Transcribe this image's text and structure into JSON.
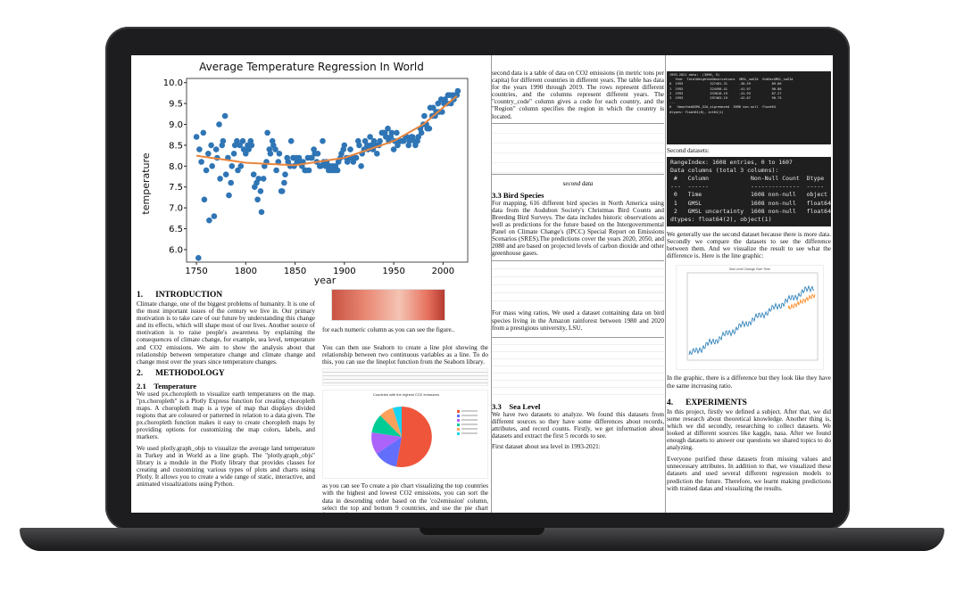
{
  "regression_chart": {
    "title": "Average Temperature Regression In World",
    "ylabel": "temperature",
    "xlabel": "year",
    "y_ticks": [
      "10.0",
      "9.5",
      "9.0",
      "8.5",
      "8.0",
      "7.5",
      "7.0",
      "6.5",
      "6.0"
    ],
    "x_ticks": [
      "1750",
      "1800",
      "1850",
      "1900",
      "1950",
      "2000"
    ],
    "point_color": "#2f75b5",
    "line_color": "#e8853d"
  },
  "chart_data": {
    "type": "scatter",
    "title": "Average Temperature Regression In World",
    "xlabel": "year",
    "ylabel": "temperature",
    "xlim": [
      1740,
      2025
    ],
    "ylim": [
      5.7,
      10.1
    ],
    "series": [
      {
        "values": [
          [
            1750,
            8.7
          ],
          [
            1752,
            5.8
          ],
          [
            1753,
            8.4
          ],
          [
            1755,
            8.1
          ],
          [
            1757,
            8.8
          ],
          [
            1758,
            7.2
          ],
          [
            1760,
            7.9
          ],
          [
            1762,
            8.3
          ],
          [
            1763,
            6.7
          ],
          [
            1765,
            8.5
          ],
          [
            1766,
            8.0
          ],
          [
            1768,
            6.8
          ],
          [
            1770,
            8.4
          ],
          [
            1771,
            8.2
          ],
          [
            1773,
            9.0
          ],
          [
            1774,
            7.7
          ],
          [
            1776,
            8.5
          ],
          [
            1777,
            8.6
          ],
          [
            1779,
            9.2
          ],
          [
            1780,
            7.8
          ],
          [
            1782,
            8.2
          ],
          [
            1783,
            7.3
          ],
          [
            1785,
            7.6
          ],
          [
            1786,
            8.0
          ],
          [
            1788,
            8.3
          ],
          [
            1789,
            8.5
          ],
          [
            1791,
            8.6
          ],
          [
            1792,
            7.9
          ],
          [
            1794,
            8.5
          ],
          [
            1795,
            8.0
          ],
          [
            1797,
            8.6
          ],
          [
            1798,
            8.4
          ],
          [
            1800,
            8.3
          ],
          [
            1802,
            8.5
          ],
          [
            1803,
            8.4
          ],
          [
            1805,
            8.6
          ],
          [
            1806,
            8.5
          ],
          [
            1808,
            7.8
          ],
          [
            1809,
            7.5
          ],
          [
            1811,
            7.6
          ],
          [
            1812,
            7.2
          ],
          [
            1813,
            7.7
          ],
          [
            1815,
            7.4
          ],
          [
            1816,
            6.9
          ],
          [
            1818,
            7.7
          ],
          [
            1819,
            8.0
          ],
          [
            1821,
            8.1
          ],
          [
            1822,
            8.8
          ],
          [
            1824,
            8.4
          ],
          [
            1825,
            8.3
          ],
          [
            1827,
            8.6
          ],
          [
            1828,
            8.5
          ],
          [
            1830,
            8.4
          ],
          [
            1831,
            7.9
          ],
          [
            1833,
            8.1
          ],
          [
            1834,
            8.3
          ],
          [
            1836,
            7.4
          ],
          [
            1837,
            7.4
          ],
          [
            1839,
            7.6
          ],
          [
            1840,
            7.8
          ],
          [
            1842,
            8.2
          ],
          [
            1843,
            8.1
          ],
          [
            1845,
            8.0
          ],
          [
            1846,
            8.6
          ],
          [
            1848,
            8.2
          ],
          [
            1849,
            8.0
          ],
          [
            1851,
            8.2
          ],
          [
            1852,
            8.1
          ],
          [
            1854,
            8.2
          ],
          [
            1855,
            8.1
          ],
          [
            1857,
            8.0
          ],
          [
            1858,
            8.1
          ],
          [
            1860,
            7.9
          ],
          [
            1861,
            7.9
          ],
          [
            1863,
            8.2
          ],
          [
            1864,
            7.9
          ],
          [
            1866,
            8.2
          ],
          [
            1867,
            8.2
          ],
          [
            1869,
            8.4
          ],
          [
            1870,
            8.3
          ],
          [
            1872,
            8.1
          ],
          [
            1873,
            8.3
          ],
          [
            1875,
            8.0
          ],
          [
            1876,
            8.0
          ],
          [
            1878,
            8.6
          ],
          [
            1879,
            8.1
          ],
          [
            1881,
            8.0
          ],
          [
            1882,
            8.1
          ],
          [
            1884,
            7.9
          ],
          [
            1885,
            8.0
          ],
          [
            1887,
            7.9
          ],
          [
            1888,
            8.0
          ],
          [
            1890,
            7.9
          ],
          [
            1891,
            8.0
          ],
          [
            1893,
            7.9
          ],
          [
            1894,
            8.1
          ],
          [
            1896,
            8.2
          ],
          [
            1897,
            8.3
          ],
          [
            1899,
            8.4
          ],
          [
            1900,
            8.5
          ],
          [
            1902,
            8.2
          ],
          [
            1903,
            8.1
          ],
          [
            1905,
            8.2
          ],
          [
            1906,
            8.4
          ],
          [
            1908,
            8.2
          ],
          [
            1909,
            8.1
          ],
          [
            1911,
            8.2
          ],
          [
            1912,
            8.2
          ],
          [
            1914,
            8.6
          ],
          [
            1915,
            8.5
          ],
          [
            1917,
            8.0
          ],
          [
            1918,
            8.3
          ],
          [
            1920,
            8.4
          ],
          [
            1921,
            8.6
          ],
          [
            1923,
            8.5
          ],
          [
            1924,
            8.4
          ],
          [
            1926,
            8.7
          ],
          [
            1927,
            8.5
          ],
          [
            1929,
            8.4
          ],
          [
            1930,
            8.6
          ],
          [
            1932,
            8.5
          ],
          [
            1933,
            8.3
          ],
          [
            1935,
            8.5
          ],
          [
            1936,
            8.6
          ],
          [
            1938,
            8.8
          ],
          [
            1939,
            8.8
          ],
          [
            1941,
            8.8
          ],
          [
            1942,
            8.7
          ],
          [
            1944,
            8.9
          ],
          [
            1945,
            8.6
          ],
          [
            1947,
            8.7
          ],
          [
            1948,
            8.8
          ],
          [
            1950,
            8.4
          ],
          [
            1951,
            8.6
          ],
          [
            1953,
            8.8
          ],
          [
            1954,
            8.5
          ],
          [
            1956,
            8.6
          ],
          [
            1957,
            8.6
          ],
          [
            1959,
            8.6
          ],
          [
            1960,
            8.6
          ],
          [
            1962,
            8.7
          ],
          [
            1963,
            8.7
          ],
          [
            1965,
            8.5
          ],
          [
            1966,
            8.6
          ],
          [
            1968,
            8.7
          ],
          [
            1969,
            8.7
          ],
          [
            1971,
            8.6
          ],
          [
            1972,
            8.5
          ],
          [
            1974,
            8.6
          ],
          [
            1975,
            8.7
          ],
          [
            1977,
            8.9
          ],
          [
            1978,
            8.8
          ],
          [
            1980,
            9.0
          ],
          [
            1981,
            9.2
          ],
          [
            1983,
            9.0
          ],
          [
            1984,
            8.9
          ],
          [
            1986,
            8.9
          ],
          [
            1987,
            9.4
          ],
          [
            1989,
            9.2
          ],
          [
            1990,
            9.4
          ],
          [
            1992,
            9.2
          ],
          [
            1993,
            9.3
          ],
          [
            1995,
            9.5
          ],
          [
            1996,
            9.3
          ],
          [
            1998,
            9.6
          ],
          [
            1999,
            9.3
          ],
          [
            2001,
            9.5
          ],
          [
            2002,
            9.6
          ],
          [
            2004,
            9.5
          ],
          [
            2005,
            9.7
          ],
          [
            2007,
            9.7
          ],
          [
            2008,
            9.5
          ],
          [
            2010,
            9.7
          ],
          [
            2011,
            9.6
          ],
          [
            2013,
            9.7
          ],
          [
            2014,
            9.7
          ],
          [
            2015,
            9.8
          ]
        ]
      }
    ],
    "trend": [
      [
        1750,
        8.25
      ],
      [
        1800,
        8.08
      ],
      [
        1850,
        8.02
      ],
      [
        1900,
        8.2
      ],
      [
        1950,
        8.6
      ],
      [
        1980,
        9.0
      ],
      [
        2015,
        9.7
      ]
    ]
  },
  "intro": {
    "heading_num": "1.",
    "heading": "INTRODUCTION",
    "p1": "Climate change, one of the biggest problems of humanity. It is one of the most important issues of the century we live in. Our primary motivation is to take care of our future by understanding this change and its effects, which will shape most of our lives. Another source of motivation is to raise people's awareness by explaining the consequences of climate change, for example, sea level, temperature and CO2 emissions. We aim to show the analysis about that relationship between temperature change and climate change and change most over the years since temperature changes."
  },
  "method": {
    "heading_num": "2.",
    "heading": "METHODOLOGY",
    "sub_num": "2.1",
    "sub": "Temperature",
    "p1": "We used px.choropleth to visualize earth temperatures on the map. \"px.choropleth\" is a Plotly Express function for creating choropleth maps. A choropleth map is a type of map that displays divided regions that are coloured or patterned in relation to a data given. The px.choropleth function makes it easy to create choropleth maps by providing options for customizing the map colors, labels, and markers.",
    "p2": "We used plotly.graph_objs to visualize the average land temperature in Turkey and in World as a line graph. The \"plotly.graph_objs\" library is a module in the Plotly library that provides classes for creating and customizing various types of plots and charts using Plotly. It allows you to create a wide range of static, interactive, and animated visualizations using Python."
  },
  "mid": {
    "p_numeric": "for each numeric column as you can see the figure..",
    "p_seaborn": "You can then use Seaborn to create a line plot showing the relationship between two continuous variables as a line. To do this, you can use the lineplot function from the Seaborn library.",
    "pie_title": "Countries with the highest CO2 emissions",
    "p_pie": "as you can see To create a pie chart visualizing the top countries with the highest and lowest CO2 emissions, you can sort the data in descending order based on the 'co2emission' column, select the top and bottom 9 countries, and use the pie chart function from a"
  },
  "col2": {
    "p_top": "second data is a table of data on CO2 emissions (in metric tons per capita) for different countries in different years. The table has data for the years 1990 through 2019. The rows represent different countries, and the columns represent different years. The \"country_code\" column gives a code for each country, and the \"Region\" column specifies the region in which the country is located.",
    "caption": "second data",
    "bird_num": "3.3",
    "bird": "Bird Species",
    "p_bird": "For mapping, 616 different bird species in North America using data from the Audubon Society's Christmas Bird Counts and Breeding Bird Surveys. The data includes historic observations as well as predictions for the future based on the Intergovernmental Panel on Climate Change's (IPCC) Special Report on Emissions Scenarios (SRES).The predictions cover the years 2020, 2050, and 2080 and are based on projected levels of carbon dioxide and other greenhouse gases.",
    "p_mass": "For mass wing ratios, We used a dataset containing data on bird species living in the Amazon rainforest between 1980 and 2020 from a prestigious university, LSU.",
    "sea_num": "3.3",
    "sea": "Sea Level",
    "p_sea": "We have two datasets to analyze. We found this datasets from different sources so they have some differences about records, attributes, and record counts. Firstly, we get information about datasets and extract the first 5 records to see.",
    "p_first": "First dataset about sea level in 1993-2021:"
  },
  "col3": {
    "p_second": "Second datasets:",
    "info_lines": [
      "RangeIndex: 1608 entries, 0 to 1607",
      "Data columns (total 3 columns):",
      " #   Column            Non-Null Count  Dtype",
      "---  ------            --------------  -----",
      " 0   Time              1608 non-null   object",
      " 1   GMSL              1608 non-null   float64",
      " 2   GMSL uncertainty  1608 non-null   float64",
      "dtypes: float64(2), object(1)"
    ],
    "head_lines": [
      "1993-2021 data:  (3096, 9)",
      "   Year  TotalWeightedObservations  GMSL_noGIA  StdDevGMSL_noGIA",
      "0  1993              327401.31      -38.59           89.86",
      "1  1993              324498.41      -41.97           90.86",
      "2  1993              333018.19      -41.93           87.27",
      "3  1993              297483.19      -42.67           90.75",
      "...",
      "0   SmoothedGSML_GIA_sigremoved  3096 non-null  float64",
      "dtypes: float64(8), int64(1)"
    ],
    "p_use": "We generally use the second dataset because there is more data. Secondly we compare  the datasets to see the difference between them. And we visualize the result to see what the difference is. Here is the line graphic:",
    "mini_title": "Sea Level Change Over Time",
    "p_graphic": "In the graphic, there is a difference but they look like they have the same increasing ratio.",
    "exp_num": "4.",
    "exp": "EXPERIMENTS",
    "p_exp1": "In this project, firstly we defined a subject. After that, we did some research about theoretical knowledge. Another thing is, which we did secondly, researching to collect datasets. We looked at different sources like kaggle, nasa. After we found enough datasets to answer our questions we shared topics to do analyzing.",
    "p_exp2": "Everyone purified these datasets from missing values and unnecessary attributes. In addition to that, we visualized these datasets and used several different regression models to prediction the future. Therefore, we learnt making predictions with trained datas and visualizing the results."
  },
  "colors": {
    "screen_bg": "#ffffff",
    "laptop": "#1d1d1f",
    "terminal": "#1f1f1f",
    "pie_red": "#ef553b"
  }
}
